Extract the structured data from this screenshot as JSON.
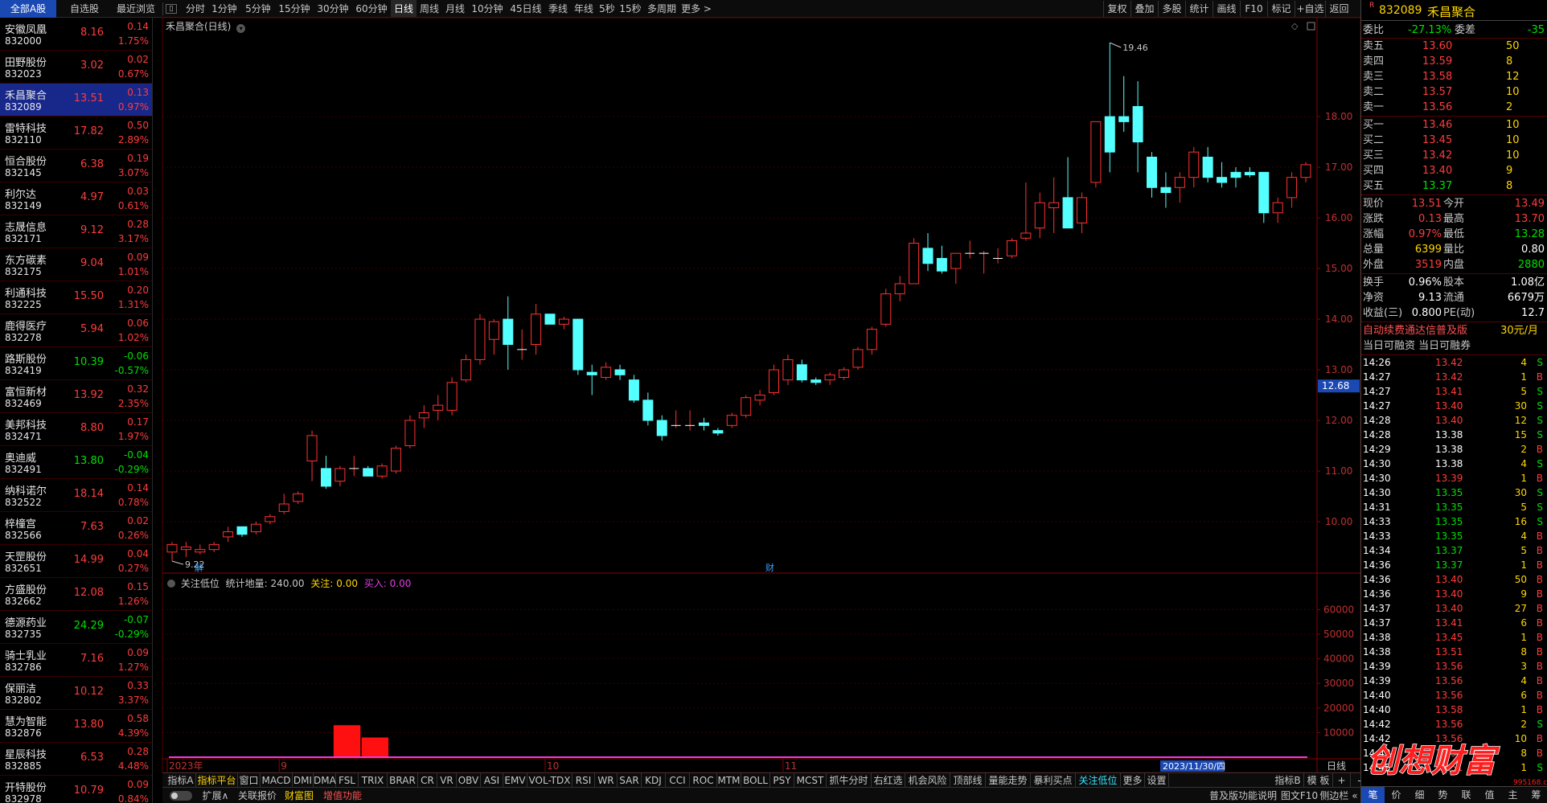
{
  "topbar": {
    "seg_all": "全部A股",
    "seg_fav": "自选股",
    "seg_recent": "最近浏览",
    "periods": [
      "分时",
      "1分钟",
      "5分钟",
      "15分钟",
      "30分钟",
      "60分钟",
      "日线",
      "周线",
      "月线",
      "10分钟",
      "45日线",
      "季线",
      "年线",
      "5秒",
      "15秒",
      "多周期",
      "更多 >"
    ],
    "right_tools": [
      "复权",
      "叠加",
      "多股",
      "统计",
      "画线",
      "F10",
      "标记",
      "+自选",
      "返回"
    ]
  },
  "stocks": [
    {
      "name": "安徽凤凰",
      "code": "832000",
      "price": "8.16",
      "chg": "0.14",
      "pct": "1.75%",
      "dir": "up"
    },
    {
      "name": "田野股份",
      "code": "832023",
      "price": "3.02",
      "chg": "0.02",
      "pct": "0.67%",
      "dir": "up"
    },
    {
      "name": "禾昌聚合",
      "code": "832089",
      "price": "13.51",
      "chg": "0.13",
      "pct": "0.97%",
      "dir": "up",
      "selected": true
    },
    {
      "name": "雷特科技",
      "code": "832110",
      "price": "17.82",
      "chg": "0.50",
      "pct": "2.89%",
      "dir": "up"
    },
    {
      "name": "恒合股份",
      "code": "832145",
      "price": "6.38",
      "chg": "0.19",
      "pct": "3.07%",
      "dir": "up"
    },
    {
      "name": "利尔达",
      "code": "832149",
      "price": "4.97",
      "chg": "0.03",
      "pct": "0.61%",
      "dir": "up"
    },
    {
      "name": "志晟信息",
      "code": "832171",
      "price": "9.12",
      "chg": "0.28",
      "pct": "3.17%",
      "dir": "up"
    },
    {
      "name": "东方碳素",
      "code": "832175",
      "price": "9.04",
      "chg": "0.09",
      "pct": "1.01%",
      "dir": "up"
    },
    {
      "name": "利通科技",
      "code": "832225",
      "price": "15.50",
      "chg": "0.20",
      "pct": "1.31%",
      "dir": "up"
    },
    {
      "name": "鹿得医疗",
      "code": "832278",
      "price": "5.94",
      "chg": "0.06",
      "pct": "1.02%",
      "dir": "up"
    },
    {
      "name": "路斯股份",
      "code": "832419",
      "price": "10.39",
      "chg": "-0.06",
      "pct": "-0.57%",
      "dir": "dn"
    },
    {
      "name": "富恒新材",
      "code": "832469",
      "price": "13.92",
      "chg": "0.32",
      "pct": "2.35%",
      "dir": "up"
    },
    {
      "name": "美邦科技",
      "code": "832471",
      "price": "8.80",
      "chg": "0.17",
      "pct": "1.97%",
      "dir": "up"
    },
    {
      "name": "奥迪威",
      "code": "832491",
      "price": "13.80",
      "chg": "-0.04",
      "pct": "-0.29%",
      "dir": "dn"
    },
    {
      "name": "纳科诺尔",
      "code": "832522",
      "price": "18.14",
      "chg": "0.14",
      "pct": "0.78%",
      "dir": "up"
    },
    {
      "name": "梓橦宫",
      "code": "832566",
      "price": "7.63",
      "chg": "0.02",
      "pct": "0.26%",
      "dir": "up"
    },
    {
      "name": "天罡股份",
      "code": "832651",
      "price": "14.99",
      "chg": "0.04",
      "pct": "0.27%",
      "dir": "up"
    },
    {
      "name": "方盛股份",
      "code": "832662",
      "price": "12.08",
      "chg": "0.15",
      "pct": "1.26%",
      "dir": "up"
    },
    {
      "name": "德源药业",
      "code": "832735",
      "price": "24.29",
      "chg": "-0.07",
      "pct": "-0.29%",
      "dir": "dn"
    },
    {
      "name": "骑士乳业",
      "code": "832786",
      "price": "7.16",
      "chg": "0.09",
      "pct": "1.27%",
      "dir": "up"
    },
    {
      "name": "保丽洁",
      "code": "832802",
      "price": "10.12",
      "chg": "0.33",
      "pct": "3.37%",
      "dir": "up"
    },
    {
      "name": "慧为智能",
      "code": "832876",
      "price": "13.80",
      "chg": "0.58",
      "pct": "4.39%",
      "dir": "up"
    },
    {
      "name": "星辰科技",
      "code": "832885",
      "price": "6.53",
      "chg": "0.28",
      "pct": "4.48%",
      "dir": "up"
    },
    {
      "name": "开特股份",
      "code": "832978",
      "price": "10.79",
      "chg": "0.09",
      "pct": "0.84%",
      "dir": "up"
    }
  ],
  "chart": {
    "title": "禾昌聚合(日线)",
    "high_label": "19.46",
    "low_label": "9.22",
    "cur_price_label": "12.68",
    "marker_jie": "解",
    "marker_cai": "财",
    "y_ticks": [
      "18.00",
      "17.00",
      "16.00",
      "15.00",
      "14.00",
      "13.00",
      "12.00",
      "11.00",
      "10.00"
    ],
    "x_labels": [
      {
        "t": "2023年",
        "i": 0
      },
      {
        "t": "9",
        "i": 8
      },
      {
        "t": "10",
        "i": 27
      },
      {
        "t": "11",
        "i": 44
      }
    ],
    "cursor_date": "2023/11/30/四",
    "period_label": "日线",
    "indicator": {
      "name": "关注低位",
      "stat_label": "统计地量:",
      "stat_value": "240.00",
      "focus_label": "关注:",
      "focus_value": "0.00",
      "buy_label": "买入:",
      "buy_value": "0.00"
    },
    "vol_ticks": [
      "60000",
      "50000",
      "40000",
      "30000",
      "20000",
      "10000"
    ]
  },
  "chart_data": {
    "type": "candlestick",
    "title": "禾昌聚合(日线)",
    "ohlc": [
      [
        9.4,
        9.6,
        9.22,
        9.55
      ],
      [
        9.45,
        9.6,
        9.3,
        9.5
      ],
      [
        9.4,
        9.55,
        9.35,
        9.45
      ],
      [
        9.45,
        9.6,
        9.4,
        9.55
      ],
      [
        9.7,
        9.9,
        9.6,
        9.8
      ],
      [
        9.9,
        9.9,
        9.7,
        9.75
      ],
      [
        9.8,
        10.0,
        9.75,
        9.95
      ],
      [
        10.0,
        10.15,
        9.95,
        10.1
      ],
      [
        10.2,
        10.55,
        10.15,
        10.35
      ],
      [
        10.4,
        10.6,
        10.35,
        10.55
      ],
      [
        11.2,
        11.8,
        10.8,
        11.7
      ],
      [
        11.05,
        11.3,
        10.65,
        10.7
      ],
      [
        10.8,
        11.1,
        10.7,
        11.05
      ],
      [
        11.05,
        11.3,
        10.9,
        11.05
      ],
      [
        11.05,
        11.1,
        10.9,
        10.9
      ],
      [
        10.9,
        11.15,
        10.85,
        11.1
      ],
      [
        11.0,
        11.5,
        10.95,
        11.45
      ],
      [
        11.5,
        12.1,
        11.45,
        12.0
      ],
      [
        12.05,
        12.3,
        11.85,
        12.15
      ],
      [
        12.2,
        12.5,
        12.0,
        12.3
      ],
      [
        12.2,
        12.85,
        12.1,
        12.75
      ],
      [
        12.8,
        13.3,
        12.75,
        13.2
      ],
      [
        13.2,
        14.1,
        13.1,
        14.0
      ],
      [
        13.6,
        14.0,
        13.3,
        13.95
      ],
      [
        14.0,
        14.45,
        13.0,
        13.5
      ],
      [
        13.4,
        13.8,
        13.2,
        13.4
      ],
      [
        13.5,
        14.3,
        13.3,
        14.1
      ],
      [
        14.1,
        14.1,
        13.9,
        13.9
      ],
      [
        13.9,
        14.05,
        13.8,
        14.0
      ],
      [
        14.0,
        14.0,
        12.9,
        13.0
      ],
      [
        12.95,
        13.1,
        12.5,
        12.9
      ],
      [
        12.85,
        13.15,
        12.8,
        13.05
      ],
      [
        13.0,
        13.1,
        12.8,
        12.9
      ],
      [
        12.8,
        12.9,
        12.35,
        12.4
      ],
      [
        12.4,
        12.55,
        11.9,
        12.0
      ],
      [
        12.0,
        12.1,
        11.6,
        11.7
      ],
      [
        11.9,
        12.2,
        11.85,
        11.9
      ],
      [
        11.9,
        12.2,
        11.8,
        11.9
      ],
      [
        11.95,
        12.05,
        11.8,
        11.9
      ],
      [
        11.8,
        11.85,
        11.7,
        11.75
      ],
      [
        11.9,
        12.15,
        11.85,
        12.1
      ],
      [
        12.1,
        12.5,
        12.05,
        12.45
      ],
      [
        12.4,
        12.6,
        12.3,
        12.5
      ],
      [
        12.55,
        13.1,
        12.5,
        13.0
      ],
      [
        12.8,
        13.3,
        12.7,
        13.2
      ],
      [
        13.1,
        13.2,
        12.75,
        12.8
      ],
      [
        12.8,
        12.85,
        12.7,
        12.75
      ],
      [
        12.8,
        12.95,
        12.7,
        12.9
      ],
      [
        12.85,
        13.05,
        12.8,
        13.0
      ],
      [
        13.05,
        13.45,
        13.0,
        13.4
      ],
      [
        13.4,
        13.85,
        13.3,
        13.8
      ],
      [
        13.9,
        14.6,
        13.85,
        14.5
      ],
      [
        14.5,
        14.85,
        14.35,
        14.7
      ],
      [
        14.7,
        15.6,
        14.7,
        15.5
      ],
      [
        15.4,
        15.7,
        14.95,
        15.1
      ],
      [
        15.2,
        15.45,
        14.9,
        14.95
      ],
      [
        15.0,
        15.3,
        14.7,
        15.3
      ],
      [
        15.3,
        15.55,
        15.2,
        15.3
      ],
      [
        15.3,
        15.35,
        14.9,
        15.3
      ],
      [
        15.2,
        15.4,
        15.1,
        15.2
      ],
      [
        15.25,
        15.6,
        15.2,
        15.55
      ],
      [
        15.6,
        16.7,
        15.55,
        15.7
      ],
      [
        15.8,
        16.5,
        15.6,
        16.3
      ],
      [
        16.2,
        16.8,
        15.7,
        16.3
      ],
      [
        16.4,
        17.2,
        16.3,
        15.8
      ],
      [
        15.9,
        16.5,
        15.7,
        16.4
      ],
      [
        16.7,
        17.9,
        16.6,
        17.9
      ],
      [
        18.0,
        19.46,
        16.9,
        17.3
      ],
      [
        18.0,
        18.8,
        17.7,
        17.9
      ],
      [
        18.2,
        18.7,
        16.9,
        17.5
      ],
      [
        17.2,
        17.3,
        16.4,
        16.6
      ],
      [
        16.6,
        16.9,
        16.2,
        16.5
      ],
      [
        16.6,
        16.9,
        16.3,
        16.8
      ],
      [
        16.8,
        17.4,
        16.6,
        17.3
      ],
      [
        17.2,
        17.4,
        16.7,
        16.8
      ],
      [
        16.8,
        17.1,
        16.6,
        16.7
      ],
      [
        16.9,
        17.0,
        16.6,
        16.8
      ],
      [
        16.9,
        17.0,
        16.8,
        16.85
      ],
      [
        16.9,
        16.9,
        15.9,
        16.1
      ],
      [
        16.1,
        16.4,
        15.9,
        16.3
      ],
      [
        16.4,
        16.9,
        16.2,
        16.8
      ],
      [
        16.8,
        17.1,
        16.7,
        17.05
      ]
    ],
    "ylim": [
      9.0,
      19.7
    ],
    "volume_bars": [
      {
        "start": 12,
        "end": 13,
        "value": 13000
      },
      {
        "start": 14,
        "end": 15,
        "value": 8000
      }
    ],
    "vol_ylim": [
      0,
      66000
    ]
  },
  "bottom_tabs": [
    "指标A",
    "指标平台",
    "窗口",
    "MACD",
    "DMI",
    "DMA",
    "FSL",
    "TRIX",
    "BRAR",
    "CR",
    "VR",
    "OBV",
    "ASI",
    "EMV",
    "VOL-TDX",
    "RSI",
    "WR",
    "SAR",
    "KDJ",
    "CCI",
    "ROC",
    "MTM",
    "BOLL",
    "PSY",
    "MCST",
    "抓牛分时",
    "右红选",
    "机会风险",
    "顶部线",
    "量能走势",
    "暴利买点",
    "关注低位",
    "更多",
    "设置"
  ],
  "bottom_tabs_right": [
    "指标B",
    "模 板",
    "+",
    "-"
  ],
  "bottom_row2": {
    "expand": "扩展∧",
    "link": "关联报价",
    "wealth": "财富图",
    "plus": "增值功能",
    "help": "普及版功能说明",
    "f10": "图文F10",
    "side": "侧边栏 «"
  },
  "right": {
    "code": "832089",
    "name": "禾昌聚合",
    "r_mark": "R",
    "weibi_label": "委比",
    "weibi": "-27.13%",
    "weicha_label": "委差",
    "weicha": "-35",
    "asks": [
      {
        "l": "卖五",
        "p": "13.60",
        "v": "50"
      },
      {
        "l": "卖四",
        "p": "13.59",
        "v": "8"
      },
      {
        "l": "卖三",
        "p": "13.58",
        "v": "12"
      },
      {
        "l": "卖二",
        "p": "13.57",
        "v": "10"
      },
      {
        "l": "卖一",
        "p": "13.56",
        "v": "2"
      }
    ],
    "bids": [
      {
        "l": "买一",
        "p": "13.46",
        "v": "10"
      },
      {
        "l": "买二",
        "p": "13.45",
        "v": "10"
      },
      {
        "l": "买三",
        "p": "13.42",
        "v": "10"
      },
      {
        "l": "买四",
        "p": "13.40",
        "v": "9"
      },
      {
        "l": "买五",
        "p": "13.37",
        "v": "8"
      }
    ],
    "quote": [
      [
        {
          "l": "现价",
          "v": "13.51",
          "c": "up"
        },
        {
          "l": "今开",
          "v": "13.49",
          "c": "up"
        }
      ],
      [
        {
          "l": "涨跌",
          "v": "0.13",
          "c": "up"
        },
        {
          "l": "最高",
          "v": "13.70",
          "c": "up"
        }
      ],
      [
        {
          "l": "涨幅",
          "v": "0.97%",
          "c": "up"
        },
        {
          "l": "最低",
          "v": "13.28",
          "c": "dn"
        }
      ],
      [
        {
          "l": "总量",
          "v": "6399",
          "c": "yl"
        },
        {
          "l": "量比",
          "v": "0.80",
          "c": "wh"
        }
      ],
      [
        {
          "l": "外盘",
          "v": "3519",
          "c": "up"
        },
        {
          "l": "内盘",
          "v": "2880",
          "c": "dn"
        }
      ]
    ],
    "info": [
      [
        {
          "l": "换手",
          "v": "0.96%"
        },
        {
          "l": "股本",
          "v": "1.08亿"
        }
      ],
      [
        {
          "l": "净资",
          "v": "9.13"
        },
        {
          "l": "流通",
          "v": "6679万"
        }
      ],
      [
        {
          "l": "收益(三)",
          "v": "0.800"
        },
        {
          "l": "PE(动)",
          "v": "12.7"
        }
      ]
    ],
    "ad_text": "自动续费通达信普及版",
    "ad_price": "30元/月",
    "margin_text": "当日可融资 当日可融券",
    "ticks": [
      [
        "14:26",
        "13.42",
        "4",
        "S"
      ],
      [
        "14:27",
        "13.42",
        "1",
        "B"
      ],
      [
        "14:27",
        "13.41",
        "5",
        "S"
      ],
      [
        "14:27",
        "13.40",
        "30",
        "S"
      ],
      [
        "14:28",
        "13.40",
        "12",
        "S"
      ],
      [
        "14:28",
        "13.38",
        "15",
        "S"
      ],
      [
        "14:29",
        "13.38",
        "2",
        "B"
      ],
      [
        "14:30",
        "13.38",
        "4",
        "S"
      ],
      [
        "14:30",
        "13.39",
        "1",
        "B"
      ],
      [
        "14:30",
        "13.35",
        "30",
        "S"
      ],
      [
        "14:31",
        "13.35",
        "5",
        "S"
      ],
      [
        "14:33",
        "13.35",
        "16",
        "S"
      ],
      [
        "14:33",
        "13.35",
        "4",
        "B"
      ],
      [
        "14:34",
        "13.37",
        "5",
        "B"
      ],
      [
        "14:36",
        "13.37",
        "1",
        "B"
      ],
      [
        "14:36",
        "13.40",
        "50",
        "B"
      ],
      [
        "14:36",
        "13.40",
        "9",
        "B"
      ],
      [
        "14:37",
        "13.40",
        "27",
        "B"
      ],
      [
        "14:37",
        "13.41",
        "6",
        "B"
      ],
      [
        "14:38",
        "13.45",
        "1",
        "B"
      ],
      [
        "14:38",
        "13.51",
        "8",
        "B"
      ],
      [
        "14:39",
        "13.56",
        "3",
        "B"
      ],
      [
        "14:39",
        "13.56",
        "4",
        "B"
      ],
      [
        "14:40",
        "13.56",
        "6",
        "B"
      ],
      [
        "14:40",
        "13.58",
        "1",
        "B"
      ],
      [
        "14:42",
        "13.56",
        "2",
        "S"
      ],
      [
        "14:42",
        "13.56",
        "10",
        "B"
      ],
      [
        "14:43",
        "13.56",
        "8",
        "B"
      ],
      [
        "14:45",
        "13.51",
        "1",
        "S"
      ]
    ],
    "foot": [
      "笔",
      "价",
      "细",
      "势",
      "联",
      "值",
      "主",
      "筹"
    ],
    "watermark": "创想财富",
    "watermark_url": "995168.cn"
  }
}
